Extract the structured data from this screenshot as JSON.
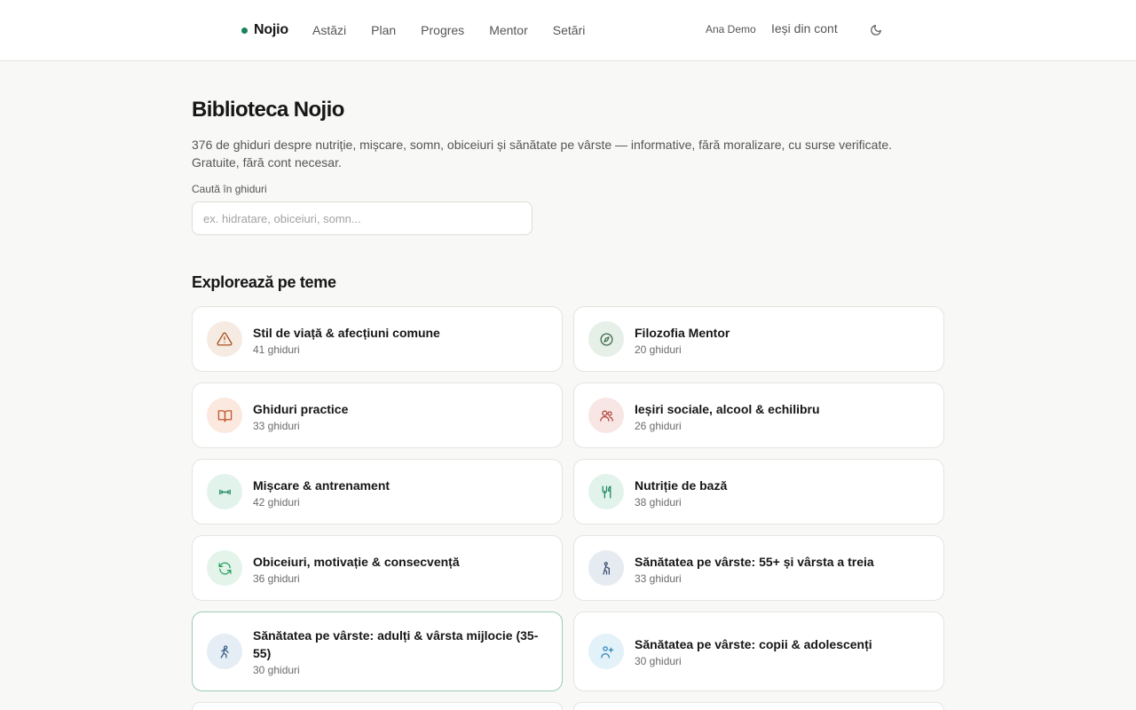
{
  "header": {
    "brand": "Nojio",
    "nav": [
      "Astăzi",
      "Plan",
      "Progres",
      "Mentor",
      "Setări"
    ],
    "user": "Ana Demo",
    "logout": "Ieși din cont",
    "theme_icon": "moon-icon"
  },
  "main": {
    "title": "Biblioteca Nojio",
    "intro": "376 de ghiduri despre nutriție, mișcare, somn, obiceiuri și sănătate pe vârste — informative, fără moralizare, cu surse verificate. Gratuite, fără cont necesar.",
    "search": {
      "label": "Caută în ghiduri",
      "placeholder": "ex. hidratare, obiceiuri, somn...",
      "value": ""
    },
    "section_title": "Explorează pe teme",
    "topics": [
      {
        "title": "Stil de viață & afecțiuni comune",
        "count": "41 ghiduri",
        "icon": "warning-triangle-icon",
        "color": "#a8521f",
        "bg": "#f6ebe3"
      },
      {
        "title": "Filozofia Mentor",
        "count": "20 ghiduri",
        "icon": "compass-icon",
        "color": "#3f6b4c",
        "bg": "#e6efe8"
      },
      {
        "title": "Ghiduri practice",
        "count": "33 ghiduri",
        "icon": "open-book-icon",
        "color": "#c0552a",
        "bg": "#fbe8de"
      },
      {
        "title": "Ieșiri sociale, alcool & echilibru",
        "count": "26 ghiduri",
        "icon": "people-icon",
        "color": "#b2453c",
        "bg": "#f8e6e4"
      },
      {
        "title": "Mișcare & antrenament",
        "count": "42 ghiduri",
        "icon": "dumbbell-icon",
        "color": "#1e8a63",
        "bg": "#e2f3ec"
      },
      {
        "title": "Nutriție de bază",
        "count": "38 ghiduri",
        "icon": "utensils-icon",
        "color": "#1e8a63",
        "bg": "#e2f3ec"
      },
      {
        "title": "Obiceiuri, motivație & consecvență",
        "count": "36 ghiduri",
        "icon": "refresh-icon",
        "color": "#22a05a",
        "bg": "#e4f4ea"
      },
      {
        "title": "Sănătatea pe vârste: 55+ și vârsta a treia",
        "count": "33 ghiduri",
        "icon": "elder-person-icon",
        "color": "#3b4f6e",
        "bg": "#e6ebf2"
      },
      {
        "title": "Sănătatea pe vârste: adulți & vârsta mijlocie (35-55)",
        "count": "30 ghiduri",
        "icon": "adult-person-icon",
        "color": "#3a5f87",
        "bg": "#e5edf5"
      },
      {
        "title": "Sănătatea pe vârste: copii & adolescenți",
        "count": "30 ghiduri",
        "icon": "child-person-icon",
        "color": "#2f87b8",
        "bg": "#e3f1f9"
      },
      {
        "title": "",
        "count": "",
        "icon": "",
        "color": "#ffffff",
        "bg": "#ffffff"
      },
      {
        "title": "",
        "count": "",
        "icon": "",
        "color": "#ffffff",
        "bg": "#ffffff"
      }
    ]
  }
}
